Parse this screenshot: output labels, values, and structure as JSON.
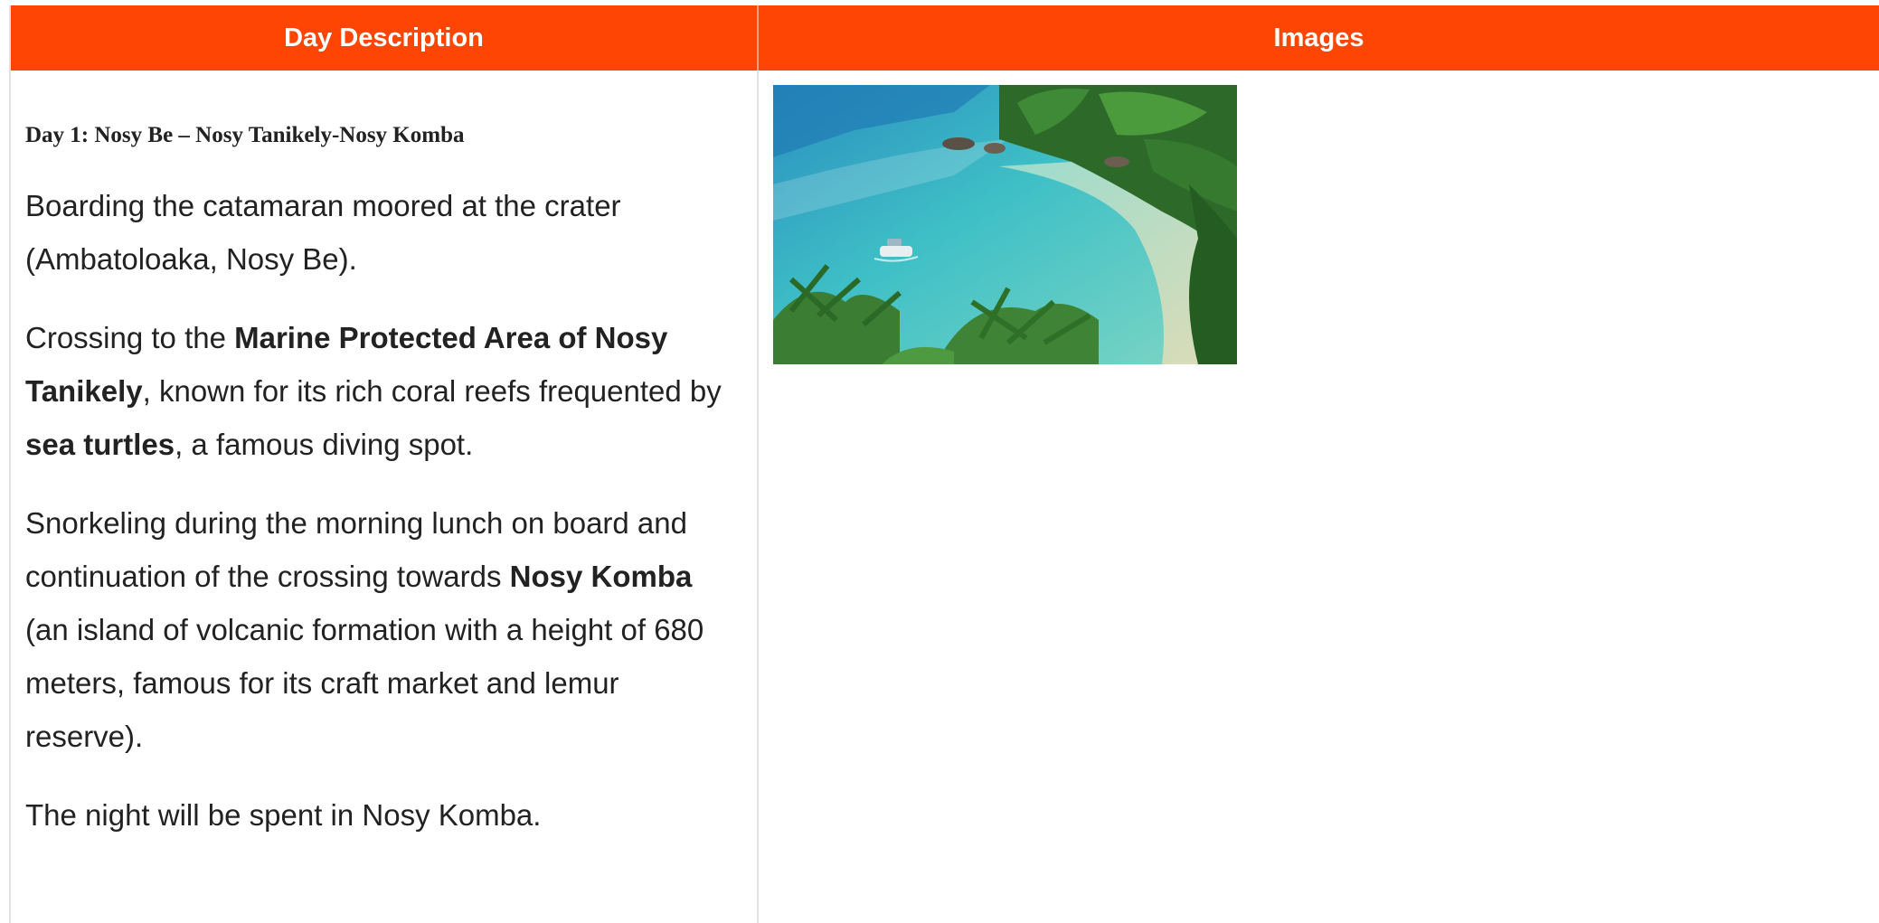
{
  "table": {
    "headers": [
      "Day Description",
      "Images"
    ]
  },
  "day": {
    "heading": "Day 1: Nosy Be – Nosy Tanikely-Nosy Komba",
    "p1": "Boarding the catamaran moored at the crater (Ambatoloaka, Nosy Be).",
    "p2": {
      "t1": "Crossing to the ",
      "b1": "Marine Protected Area of Nosy Tanikely",
      "t2": ", known for its rich coral reefs frequented by ",
      "b2": "sea turtles",
      "t3": ", a famous diving spot."
    },
    "p3": {
      "t1": "Snorkeling during the morning lunch on board and continuation of the crossing towards ",
      "b1": "Nosy Komba",
      "t2": " (an island of volcanic formation with a height of 680 meters, famous for its craft market and lemur reserve)."
    },
    "p4": "The night will be spent in Nosy Komba."
  },
  "colors": {
    "header_bg": "#fe4503",
    "header_text": "#ffffff",
    "border": "#e1e1e1"
  }
}
